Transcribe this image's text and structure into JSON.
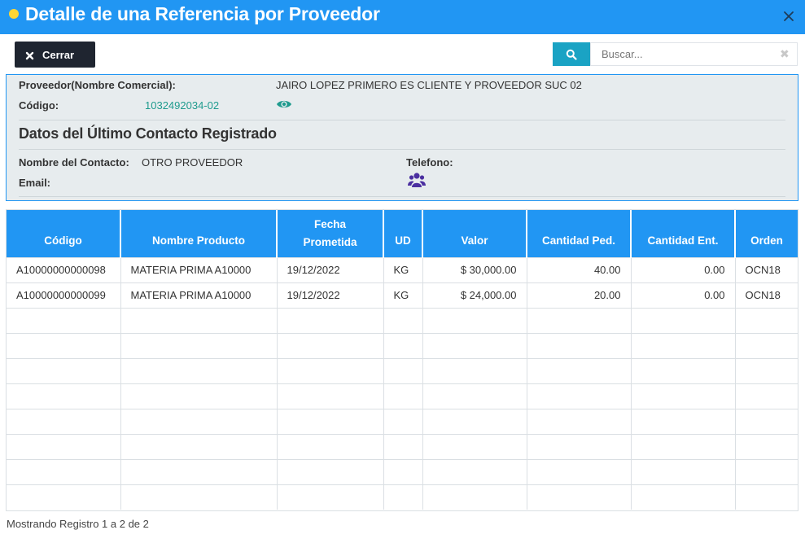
{
  "window": {
    "title": "Detalle de una Referencia por Proveedor"
  },
  "toolbar": {
    "close_label": "Cerrar",
    "search_placeholder": "Buscar...",
    "search_clear": "✖"
  },
  "provider": {
    "name_label": "Proveedor(Nombre Comercial):",
    "name_value": "JAIRO LOPEZ PRIMERO ES CLIENTE Y PROVEEDOR SUC 02",
    "code_label": "Código:",
    "code_value": "1032492034-02"
  },
  "contact": {
    "section_title": "Datos del Último Contacto Registrado",
    "name_label": "Nombre del Contacto:",
    "name_value": "OTRO PROVEEDOR",
    "phone_label": "Telefono:",
    "email_label": "Email:"
  },
  "table": {
    "columns": [
      "Código",
      "Nombre Producto",
      "Fecha Prometida",
      "UD",
      "Valor",
      "Cantidad Ped.",
      "Cantidad Ent.",
      "Orden"
    ],
    "rows": [
      [
        "A10000000000098",
        "MATERIA PRIMA A10000",
        "19/12/2022",
        "KG",
        "$ 30,000.00",
        "40.00",
        "0.00",
        "OCN18"
      ],
      [
        "A10000000000099",
        "MATERIA PRIMA A10000",
        "19/12/2022",
        "KG",
        "$ 24,000.00",
        "20.00",
        "0.00",
        "OCN18"
      ]
    ]
  },
  "footer": {
    "status": "Mostrando Registro 1 a 2 de 2"
  },
  "colors": {
    "header_blue": "#2196f3",
    "search_teal": "#1aa3c4",
    "link_teal": "#1f9b8e",
    "users_icon_purple": "#4b2fa0",
    "dot_yellow": "#ffd633",
    "dark_button": "#1f2530"
  }
}
